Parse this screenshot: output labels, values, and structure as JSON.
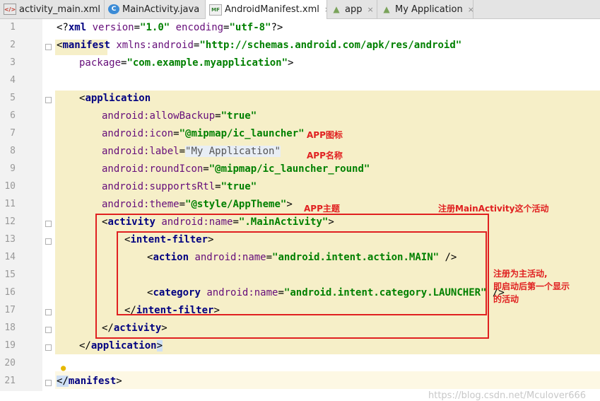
{
  "tabs": [
    {
      "label": "activity_main.xml",
      "icon": "xml-layout-icon"
    },
    {
      "label": "MainActivity.java",
      "icon": "java-class-icon"
    },
    {
      "label": "AndroidManifest.xml",
      "icon": "manifest-icon",
      "active": true
    },
    {
      "label": "app",
      "icon": "android-module-icon"
    },
    {
      "label": "My Application",
      "icon": "android-module-icon"
    }
  ],
  "close_glyph": "×",
  "line_numbers": [
    "1",
    "2",
    "3",
    "4",
    "5",
    "6",
    "7",
    "8",
    "9",
    "10",
    "11",
    "12",
    "13",
    "14",
    "15",
    "16",
    "17",
    "18",
    "19",
    "20",
    "21"
  ],
  "code": {
    "l1": {
      "proc_open": "<?",
      "tag": "xml",
      "a1": " version",
      "eq1": "=",
      "v1": "\"1.0\"",
      "a2": " encoding",
      "eq2": "=",
      "v2": "\"utf-8\"",
      "proc_close": "?>"
    },
    "l2": {
      "lt": "<",
      "tag": "manifest",
      "sp": " ",
      "ns": "xmlns:",
      "attr": "android",
      "eq": "=",
      "val": "\"http://schemas.android.com/apk/res/android\""
    },
    "l3": {
      "attr": "package",
      "eq": "=",
      "val": "\"com.example.myapplication\"",
      "gt": ">"
    },
    "l5": {
      "lt": "<",
      "tag": "application"
    },
    "l6": {
      "ns": "android:",
      "attr": "allowBackup",
      "eq": "=",
      "val": "\"true\""
    },
    "l7": {
      "ns": "android:",
      "attr": "icon",
      "eq": "=",
      "val": "\"@mipmap/ic_launcher\""
    },
    "l8": {
      "ns": "android:",
      "attr": "label",
      "eq": "=",
      "val": "\"My Application\""
    },
    "l9": {
      "ns": "android:",
      "attr": "roundIcon",
      "eq": "=",
      "val": "\"@mipmap/ic_launcher_round\""
    },
    "l10": {
      "ns": "android:",
      "attr": "supportsRtl",
      "eq": "=",
      "val": "\"true\""
    },
    "l11": {
      "ns": "android:",
      "attr": "theme",
      "eq": "=",
      "val": "\"@style/AppTheme\"",
      "gt": ">"
    },
    "l12": {
      "lt": "<",
      "tag": "activity",
      "sp": " ",
      "ns": "android:",
      "attr": "name",
      "eq": "=",
      "val": "\".MainActivity\"",
      "gt": ">"
    },
    "l13": {
      "lt": "<",
      "tag": "intent-filter",
      "gt": ">"
    },
    "l14": {
      "lt": "<",
      "tag": "action",
      "sp": " ",
      "ns": "android:",
      "attr": "name",
      "eq": "=",
      "val": "\"android.intent.action.MAIN\"",
      "end": " />"
    },
    "l16": {
      "lt": "<",
      "tag": "category",
      "sp": " ",
      "ns": "android:",
      "attr": "name",
      "eq": "=",
      "val": "\"android.intent.category.LAUNCHER\"",
      "end": " />"
    },
    "l17": {
      "lt": "</",
      "tag": "intent-filter",
      "gt": ">"
    },
    "l18": {
      "lt": "</",
      "tag": "activity",
      "gt": ">"
    },
    "l19": {
      "lt": "</",
      "tag": "application",
      "gt": ">"
    },
    "l21": {
      "lt": "</",
      "tag": "manifest",
      "gt": ">"
    }
  },
  "annotations": {
    "app_icon": "APP图标",
    "app_name": "APP名称",
    "app_theme": "APP主题",
    "register_activity": "注册MainActivity这个活动",
    "main_activity_note_1": "注册为主活动,",
    "main_activity_note_2": "即启动后第一个显示",
    "main_activity_note_3": "的活动"
  },
  "watermark": "https://blog.csdn.net/Mculover666",
  "colors": {
    "annotation_red": "#e02020",
    "tag_blue": "#000080",
    "attr_purple": "#660e7a",
    "value_green": "#008000",
    "highlight_yellow": "#f6efc8"
  }
}
